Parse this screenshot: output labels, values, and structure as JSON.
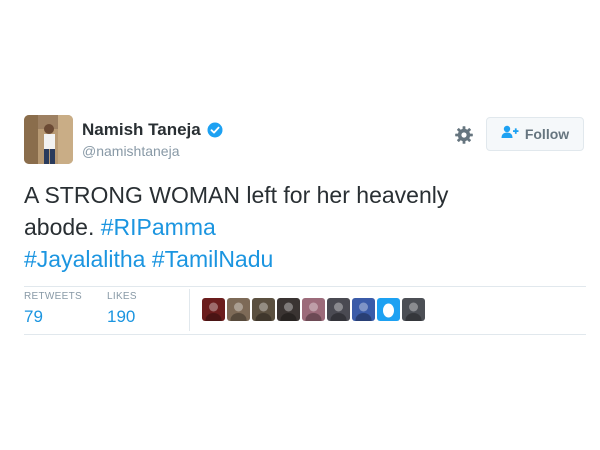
{
  "user": {
    "name": "Namish Taneja",
    "handle": "@namishtaneja",
    "avatar_icon": "profile-photo",
    "verified_icon": "verified-badge-icon"
  },
  "actions": {
    "settings_icon": "gear-icon",
    "follow_icon": "follow-user-icon",
    "follow_label": "Follow"
  },
  "tweet": {
    "line1": "A STRONG WOMAN left for her heavenly",
    "line2_text": "abode. ",
    "hashtags": [
      "#RIPamma",
      "#Jayalalitha",
      "#TamilNadu"
    ]
  },
  "stats": {
    "retweets_label": "RETWEETS",
    "retweets_value": "79",
    "likes_label": "LIKES",
    "likes_value": "190"
  },
  "likers": [
    {
      "icon": "liker-avatar-1",
      "color": "#6b1d1d"
    },
    {
      "icon": "liker-avatar-2",
      "color": "#7d6a57"
    },
    {
      "icon": "liker-avatar-3",
      "color": "#5b5040"
    },
    {
      "icon": "liker-avatar-4",
      "color": "#3a3432"
    },
    {
      "icon": "liker-avatar-5",
      "color": "#9c6b7a"
    },
    {
      "icon": "liker-avatar-6",
      "color": "#4a4a52"
    },
    {
      "icon": "liker-avatar-7",
      "color": "#3b5ba8"
    },
    {
      "icon": "liker-avatar-egg",
      "color": "#1da1f2"
    },
    {
      "icon": "liker-avatar-9",
      "color": "#4c4f55"
    }
  ],
  "colors": {
    "link": "#1b95e0",
    "muted": "#8899a6",
    "border": "#e1e8ed"
  }
}
